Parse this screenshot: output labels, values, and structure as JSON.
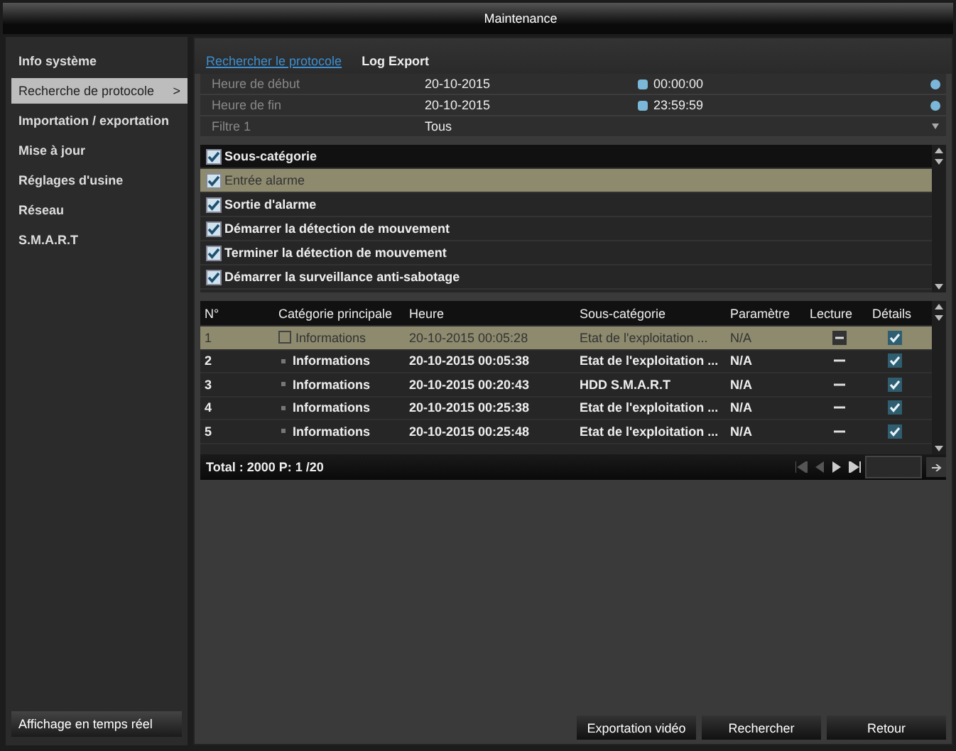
{
  "window": {
    "title": "Maintenance"
  },
  "sidebar": {
    "items": [
      {
        "label": "Info système",
        "selected": false
      },
      {
        "label": "Recherche de protocole",
        "selected": true,
        "arrow": ">"
      },
      {
        "label": "Importation / exportation",
        "selected": false
      },
      {
        "label": "Mise à jour",
        "selected": false
      },
      {
        "label": "Réglages d'usine",
        "selected": false
      },
      {
        "label": "Réseau",
        "selected": false
      },
      {
        "label": "S.M.A.R.T",
        "selected": false
      }
    ],
    "footer_button": "Affichage en temps réel"
  },
  "tabs": [
    {
      "label": "Rechercher le protocole",
      "selected": true
    },
    {
      "label": "Log Export",
      "selected": false
    }
  ],
  "filters": [
    {
      "kind": "datetime",
      "label": "Heure de début",
      "date": "20-10-2015",
      "time": "00:00:00"
    },
    {
      "kind": "datetime",
      "label": "Heure de fin",
      "date": "20-10-2015",
      "time": "23:59:59"
    },
    {
      "kind": "select",
      "label": "Filtre 1",
      "value": "Tous"
    }
  ],
  "checklist": [
    {
      "kind": "header",
      "label": "Sous-catégorie",
      "checked": true,
      "selected": false
    },
    {
      "kind": "item",
      "label": "Entrée alarme",
      "checked": true,
      "selected": true
    },
    {
      "kind": "item",
      "label": "Sortie d'alarme",
      "checked": true,
      "selected": false
    },
    {
      "kind": "item",
      "label": "Démarrer la détection de mouvement",
      "checked": true,
      "selected": false
    },
    {
      "kind": "item",
      "label": "Terminer la détection de mouvement",
      "checked": true,
      "selected": false
    },
    {
      "kind": "item",
      "label": "Démarrer la surveillance anti-sabotage",
      "checked": true,
      "selected": false
    }
  ],
  "table": {
    "columns": [
      "N°",
      "Catégorie principale",
      "Heure",
      "Sous-catégorie",
      "Paramètre",
      "Lecture",
      "Détails"
    ],
    "rows": [
      {
        "no": "1",
        "category": "Informations",
        "time": "20-10-2015 00:05:28",
        "subcategory": "Etat de l'exploitation ...",
        "parameter": "N/A",
        "selected": true
      },
      {
        "no": "2",
        "category": "Informations",
        "time": "20-10-2015 00:05:38",
        "subcategory": "Etat de l'exploitation ...",
        "parameter": "N/A",
        "selected": false
      },
      {
        "no": "3",
        "category": "Informations",
        "time": "20-10-2015 00:20:43",
        "subcategory": "HDD S.M.A.R.T",
        "parameter": "N/A",
        "selected": false
      },
      {
        "no": "4",
        "category": "Informations",
        "time": "20-10-2015 00:25:38",
        "subcategory": "Etat de l'exploitation ...",
        "parameter": "N/A",
        "selected": false
      },
      {
        "no": "5",
        "category": "Informations",
        "time": "20-10-2015 00:25:48",
        "subcategory": "Etat de l'exploitation ...",
        "parameter": "N/A",
        "selected": false
      }
    ],
    "total": "Total : 2000 P: 1 /20"
  },
  "buttons": [
    "Exportation vidéo",
    "Rechercher",
    "Retour"
  ]
}
